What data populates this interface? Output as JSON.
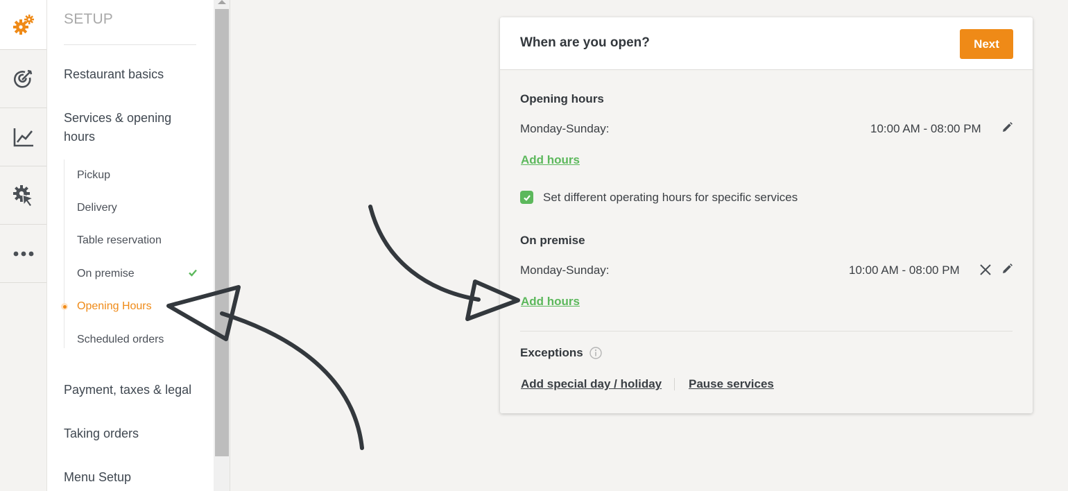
{
  "rail": {
    "items": [
      {
        "icon": "settings-gears-icon",
        "color": "#ef8a17"
      },
      {
        "icon": "target-icon"
      },
      {
        "icon": "analytics-chart-icon"
      },
      {
        "icon": "gear-cursor-icon"
      },
      {
        "icon": "more-dots-icon"
      }
    ]
  },
  "nav": {
    "title": "SETUP",
    "items": {
      "restaurant_basics": "Restaurant basics",
      "services_hours": "Services & opening hours",
      "payment": "Payment, taxes & legal",
      "taking_orders": "Taking orders",
      "menu_setup": "Menu Setup"
    },
    "sub_items": {
      "pickup": "Pickup",
      "delivery": "Delivery",
      "table_reservation": "Table reservation",
      "on_premise": "On premise",
      "opening_hours": "Opening Hours",
      "scheduled_orders": "Scheduled orders"
    },
    "active": "Opening Hours",
    "accent": "#ef8a17"
  },
  "card": {
    "title": "When are you open?",
    "next_label": "Next",
    "opening_hours": {
      "title": "Opening hours",
      "day": "Monday-Sunday:",
      "time": "10:00 AM - 08:00 PM",
      "add_label": "Add hours"
    },
    "checkbox_label": "Set different operating hours for specific services",
    "checkbox_checked": true,
    "on_premise": {
      "title": "On premise",
      "day": "Monday-Sunday:",
      "time": "10:00 AM - 08:00 PM",
      "add_label": "Add hours"
    },
    "exceptions": {
      "title": "Exceptions",
      "special_day_label": "Add special day / holiday",
      "pause_label": "Pause services"
    }
  },
  "colors": {
    "accent": "#ef8a17",
    "success": "#5cb85c",
    "arrow": "#33383d"
  }
}
